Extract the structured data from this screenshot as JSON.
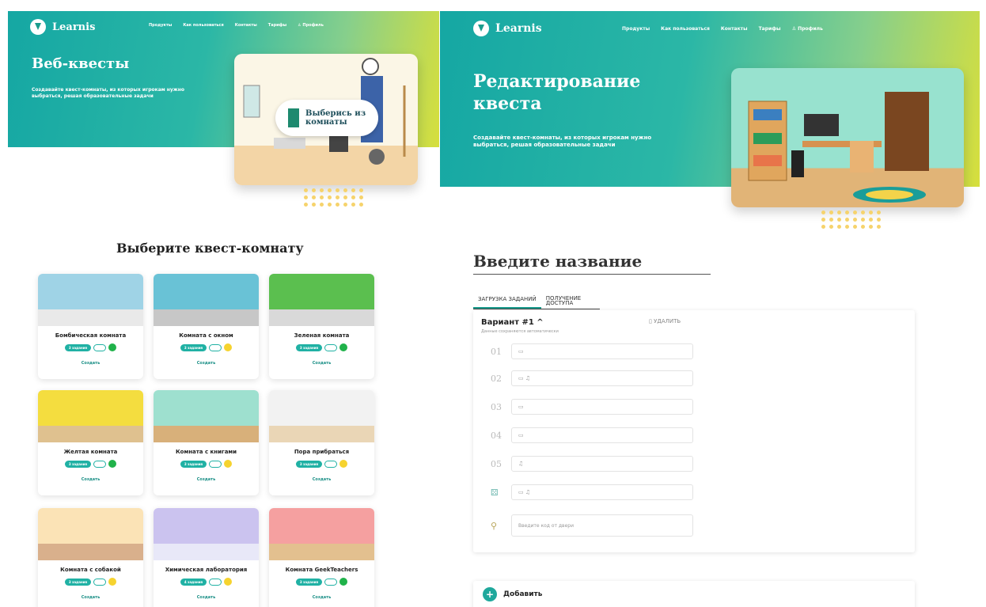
{
  "brand": "Learnis",
  "nav": [
    "Продукты",
    "Как пользоваться",
    "Контакты",
    "Тарифы",
    "Профиль"
  ],
  "left_page": {
    "hero_title": "Веб-квесты",
    "hero_subtitle": "Создавайте квест-комнаты, из которых игрокам нужно выбраться, решая образовательные задачи",
    "badge": "Выберись из комнаты",
    "section_title": "Выберите квест-комнату",
    "create_label": "Создать",
    "rooms": [
      {
        "name": "Бомбическая комната",
        "tag": "3 задания",
        "dot": "green",
        "colors": [
          "#9fd3e6",
          "#e9e9e9"
        ]
      },
      {
        "name": "Комната с окном",
        "tag": "3 задания",
        "dot": "yellow",
        "colors": [
          "#69c2d6",
          "#c7c7c7"
        ]
      },
      {
        "name": "Зеленая комната",
        "tag": "3 задания",
        "dot": "green",
        "colors": [
          "#5bbf4f",
          "#d9d9d9"
        ]
      },
      {
        "name": "Желтая комната",
        "tag": "3 задания",
        "dot": "green",
        "colors": [
          "#f4dd3f",
          "#dfc18f"
        ]
      },
      {
        "name": "Комната с книгами",
        "tag": "3 задания",
        "dot": "yellow",
        "colors": [
          "#9ee0cf",
          "#d8b07a"
        ]
      },
      {
        "name": "Пора прибраться",
        "tag": "3 задания",
        "dot": "yellow",
        "colors": [
          "#f2f2f2",
          "#ead6b6"
        ]
      },
      {
        "name": "Комната с собакой",
        "tag": "3 задания",
        "dot": "yellow",
        "colors": [
          "#fbe3b6",
          "#d9b08c"
        ]
      },
      {
        "name": "Химическая лаборатория",
        "tag": "4 задания",
        "dot": "yellow",
        "colors": [
          "#cbc3ef",
          "#e8e8f8"
        ]
      },
      {
        "name": "Комната GeekTeachers",
        "tag": "3 задания",
        "dot": "green",
        "colors": [
          "#f5a0a0",
          "#e3c08f"
        ]
      }
    ]
  },
  "right_page": {
    "hero_title": "Редактирование квеста",
    "hero_subtitle": "Создавайте квест-комнаты, из которых игрокам нужно выбраться, решая образовательные задачи",
    "name_placeholder": "Введите название",
    "tabs": [
      "ЗАГРУЗКА ЗАДАНИЙ",
      "ПОЛУЧЕНИЕ ДОСТУПА"
    ],
    "variant_title": "Вариант #1",
    "variant_note": "Данные сохраняются автоматически",
    "delete_label": "УДАЛИТЬ",
    "task_rows": [
      {
        "num": "01",
        "icons": "▭"
      },
      {
        "num": "02",
        "icons": "▭ ♫"
      },
      {
        "num": "03",
        "icons": "▭"
      },
      {
        "num": "04",
        "icons": "▭"
      },
      {
        "num": "05",
        "icons": "♫"
      },
      {
        "num": "",
        "icons": "▭ ♫"
      }
    ],
    "code_placeholder": "Введите код от двери",
    "add_label": "Добавить"
  },
  "colors": {
    "accent": "#1fa89c",
    "hero_start": "#15a7a3",
    "hero_end": "#d7df3c"
  }
}
